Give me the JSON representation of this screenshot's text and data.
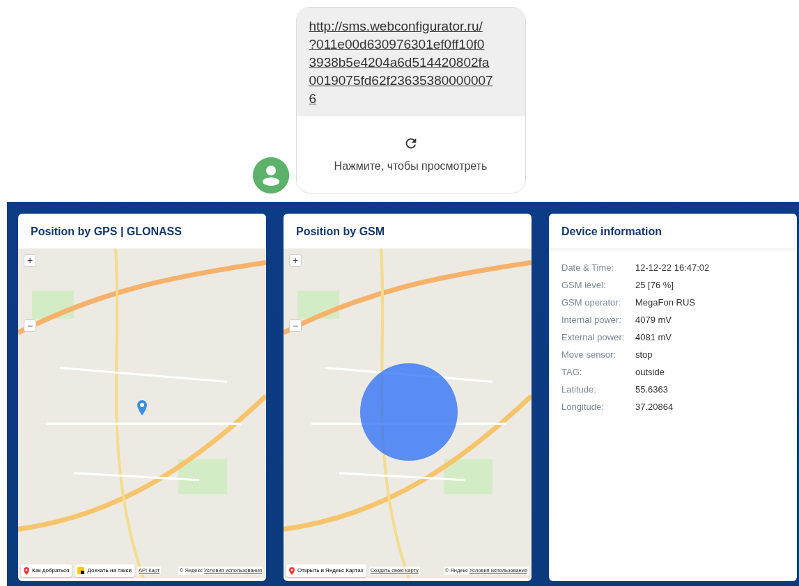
{
  "message": {
    "link_lines": [
      "http://sms.webconfigurator.ru/",
      "?011e00d630976301ef0ff10f0",
      "3938b5e4204a6d514420802fa",
      "0019075fd62f23635380000007",
      "6"
    ],
    "action": "Нажмите, чтобы просмотреть"
  },
  "cards": [
    {
      "kind": "pinmap",
      "title": "Position by GPS | GLONASS",
      "zoom_in": "+",
      "zoom_out": "−",
      "footer": [
        {
          "kind": "pin",
          "text": "Как добраться"
        },
        {
          "kind": "taxi",
          "text": "Доехать на такси"
        },
        {
          "kind": "link",
          "text": "API Карт"
        }
      ],
      "copyright": "© Яндекс",
      "terms": "Условия использования"
    },
    {
      "kind": "circlemap",
      "title": "Position by GSM",
      "zoom_in": "+",
      "zoom_out": "−",
      "footer": [
        {
          "kind": "pin",
          "text": "Открыть в Яндекс Картах"
        },
        {
          "kind": "link",
          "text": "Создать свою карту"
        }
      ],
      "copyright": "© Яндекс",
      "terms": "Условия использования"
    },
    {
      "kind": "info",
      "title": "Device information",
      "rows": [
        {
          "label": "Date & Time:",
          "value": "12-12-22 16:47:02"
        },
        {
          "label": "GSM level:",
          "value": "25 [76 %]"
        },
        {
          "label": "GSM operator:",
          "value": "MegaFon RUS"
        },
        {
          "label": "Internal power:",
          "value": "4079 mV"
        },
        {
          "label": "External power:",
          "value": "4081 mV"
        },
        {
          "label": "Move sensor:",
          "value": "stop"
        },
        {
          "label": "TAG:",
          "value": "outside"
        },
        {
          "label": "Latitude:",
          "value": "55.6363"
        },
        {
          "label": "Longitude:",
          "value": "37.20864"
        }
      ]
    }
  ]
}
